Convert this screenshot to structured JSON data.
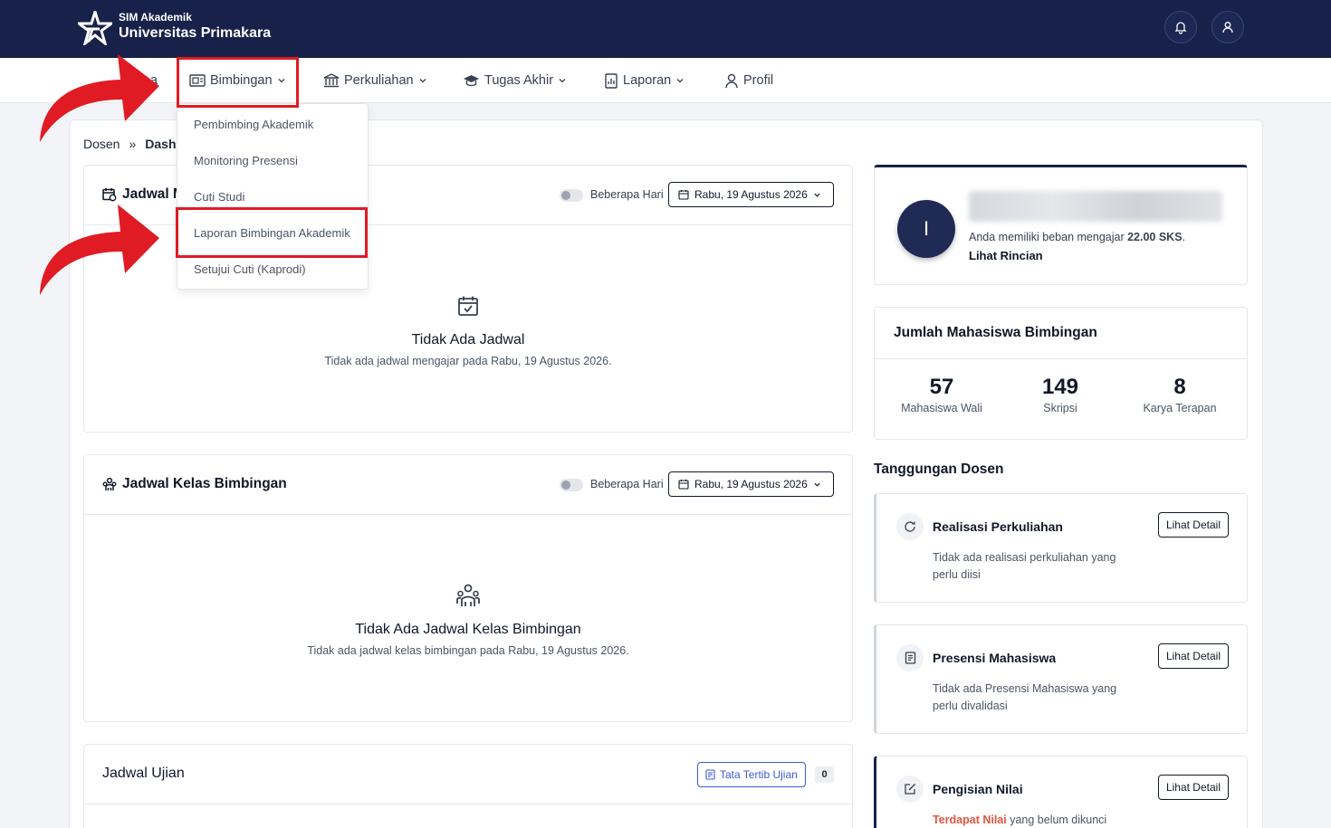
{
  "header": {
    "brand_small": "SIM Akademik",
    "brand_big": "Universitas Primakara",
    "bell_icon": "bell-icon",
    "user_icon": "user-icon"
  },
  "nav": {
    "hidden_first": "a",
    "items": [
      {
        "label": "Bimbingan",
        "icon": "guidance-icon"
      },
      {
        "label": "Perkuliahan",
        "icon": "institution-icon"
      },
      {
        "label": "Tugas Akhir",
        "icon": "graduation-cap-icon"
      },
      {
        "label": "Laporan",
        "icon": "report-icon"
      },
      {
        "label": "Profil",
        "icon": "user-icon"
      }
    ]
  },
  "dropdown": {
    "items": [
      "Pembimbing Akademik",
      "Monitoring Presensi",
      "Cuti Studi",
      "Laporan Bimbingan Akademik",
      "Setujui Cuti (Kaprodi)"
    ]
  },
  "breadcrumb": {
    "root": "Dosen",
    "sep": "»",
    "current": "Dash"
  },
  "jadwal_mengajar": {
    "title": "Jadwal M",
    "toggle_label": "Beberapa Hari",
    "date": "Rabu, 19 Agustus 2026",
    "empty_title": "Tidak Ada Jadwal",
    "empty_sub": "Tidak ada jadwal mengajar pada Rabu, 19 Agustus 2026."
  },
  "jadwal_bimbingan": {
    "title": "Jadwal Kelas Bimbingan",
    "toggle_label": "Beberapa Hari",
    "date": "Rabu, 19 Agustus 2026",
    "empty_title": "Tidak Ada Jadwal Kelas Bimbingan",
    "empty_sub": "Tidak ada jadwal kelas bimbingan pada Rabu, 19 Agustus 2026."
  },
  "jadwal_ujian": {
    "title": "Jadwal Ujian",
    "rules_button": "Tata Tertib Ujian",
    "count": "0"
  },
  "profile": {
    "initial": "I",
    "load_prefix": "Anda memiliki beban mengajar ",
    "load_value": "22.00 SKS",
    "load_suffix": ".",
    "detail_link": "Lihat Rincian"
  },
  "stats": {
    "title": "Jumlah Mahasiswa Bimbingan",
    "items": [
      {
        "value": "57",
        "label": "Mahasiswa Wali"
      },
      {
        "value": "149",
        "label": "Skripsi"
      },
      {
        "value": "8",
        "label": "Karya Terapan"
      }
    ]
  },
  "tanggungan": {
    "title": "Tanggungan Dosen",
    "items": [
      {
        "title": "Realisasi Perkuliahan",
        "desc": "Tidak ada realisasi perkuliahan yang perlu diisi",
        "button": "Lihat Detail",
        "icon": "refresh-icon"
      },
      {
        "title": "Presensi Mahasiswa",
        "desc": "Tidak ada Presensi Mahasiswa yang perlu divalidasi",
        "button": "Lihat Detail",
        "icon": "document-icon"
      },
      {
        "title": "Pengisian Nilai",
        "desc_highlight": "Terdapat Nilai",
        "desc": " yang belum dikunci",
        "button": "Lihat Detail",
        "icon": "edit-icon"
      }
    ]
  },
  "colors": {
    "navy": "#17214a",
    "highlight_red": "#e01b24",
    "accent_blue": "#3b5bdb",
    "warning_red": "#e5533d"
  }
}
